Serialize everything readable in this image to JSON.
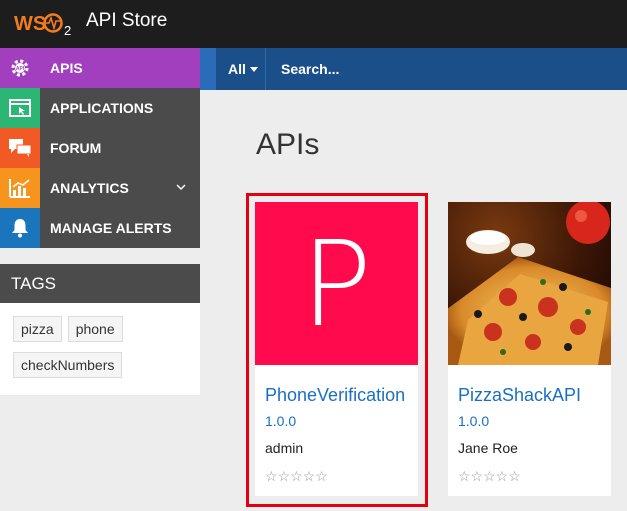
{
  "header": {
    "logo_text": "WSO2",
    "title": "API Store"
  },
  "sidebar": {
    "items": [
      {
        "label": "APIS",
        "icon": "api-gear-icon",
        "color": "#a23fbf",
        "active": true
      },
      {
        "label": "APPLICATIONS",
        "icon": "window-icon",
        "color": "#2bb673"
      },
      {
        "label": "FORUM",
        "icon": "chat-icon",
        "color": "#f15a24"
      },
      {
        "label": "ANALYTICS",
        "icon": "bar-chart-icon",
        "color": "#f7941d"
      },
      {
        "label": "MANAGE ALERTS",
        "icon": "bell-icon",
        "color": "#1b75bc"
      }
    ]
  },
  "tags": {
    "title": "TAGS",
    "items": [
      "pizza",
      "phone",
      "checkNumbers"
    ]
  },
  "search": {
    "filter_label": "All",
    "placeholder": "Search..."
  },
  "main": {
    "title": "APIs",
    "apis": [
      {
        "name": "PhoneVerification",
        "version": "1.0.0",
        "provider": "admin",
        "thumb_letter": "P",
        "thumb_color": "#ff0a4c",
        "rating": "☆☆☆☆☆",
        "highlighted": true
      },
      {
        "name": "PizzaShackAPI",
        "version": "1.0.0",
        "provider": "Jane Roe",
        "thumb": "pizza-photo",
        "rating": "☆☆☆☆☆"
      }
    ]
  },
  "colors": {
    "topbar": "#1d1d1d",
    "searchbar": "#1b4f8a",
    "highlight": "#e3000f",
    "link": "#1a6fc4"
  }
}
